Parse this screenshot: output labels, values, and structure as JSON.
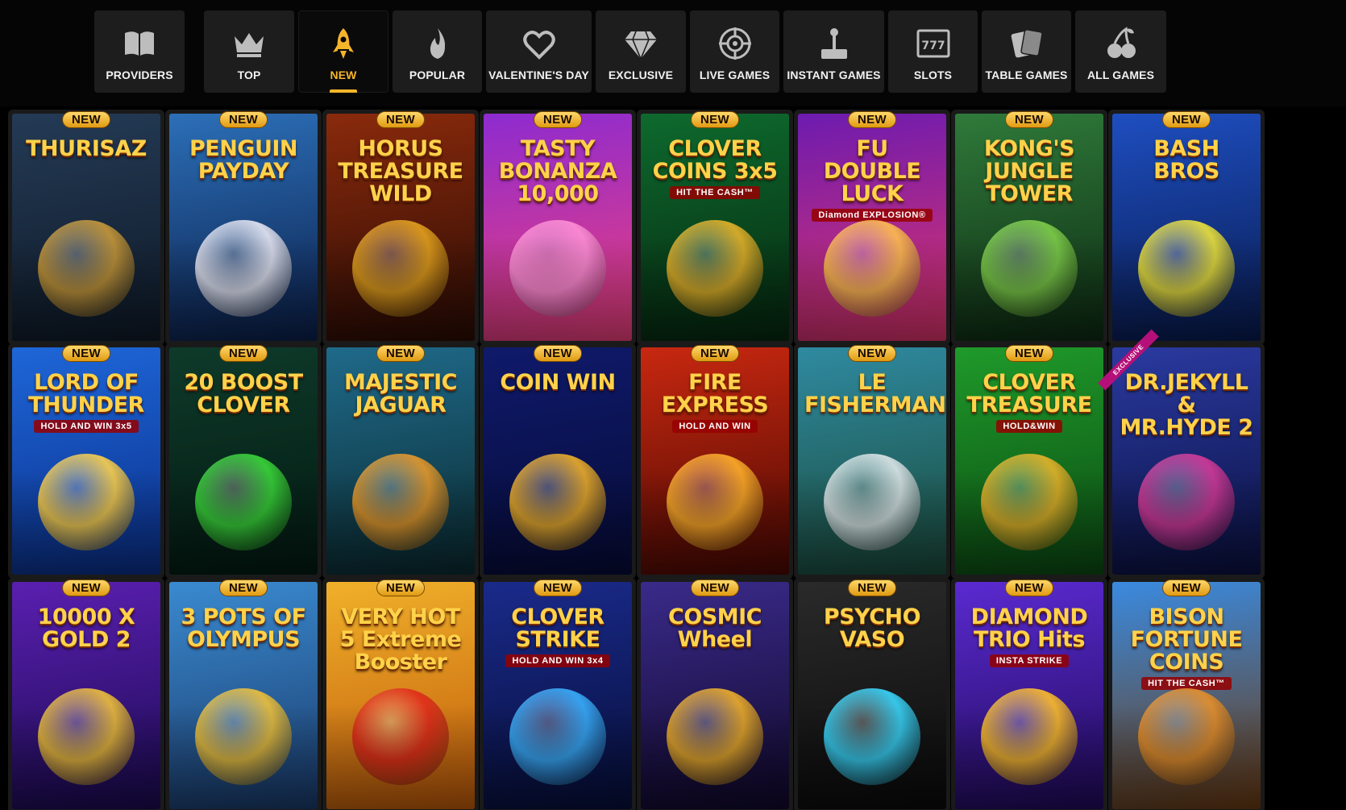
{
  "nav": {
    "categories": [
      {
        "label": "PROVIDERS",
        "icon": "book-icon",
        "active": false
      },
      {
        "label": "TOP",
        "icon": "crown-icon",
        "active": false
      },
      {
        "label": "NEW",
        "icon": "rocket-icon",
        "active": true
      },
      {
        "label": "POPULAR",
        "icon": "flame-icon",
        "active": false
      },
      {
        "label": "VALENTINE'S DAY",
        "icon": "heart-icon",
        "active": false
      },
      {
        "label": "EXCLUSIVE",
        "icon": "diamond-icon",
        "active": false
      },
      {
        "label": "LIVE GAMES",
        "icon": "roulette-icon",
        "active": false
      },
      {
        "label": "INSTANT GAMES",
        "icon": "joystick-icon",
        "active": false
      },
      {
        "label": "SLOTS",
        "icon": "slot-machine-icon",
        "active": false
      },
      {
        "label": "TABLE GAMES",
        "icon": "cards-icon",
        "active": false
      },
      {
        "label": "ALL GAMES",
        "icon": "cherries-icon",
        "active": false
      }
    ],
    "accent_color": "#f5b52a"
  },
  "games": [
    {
      "title": "THURISAZ",
      "subtitle": "",
      "badge": "NEW",
      "bg": [
        "#243a55",
        "#0e1a28"
      ],
      "accent": "#c99a3a"
    },
    {
      "title": "PENGUIN PAYDAY",
      "subtitle": "",
      "badge": "NEW",
      "bg": [
        "#2c6fb8",
        "#0b1f4a"
      ],
      "accent": "#e9e9f5"
    },
    {
      "title": "HORUS TREASURE WILD",
      "subtitle": "",
      "badge": "NEW",
      "bg": [
        "#8a2a0c",
        "#2a0b04"
      ],
      "accent": "#e4a21e"
    },
    {
      "title": "TASTY BONANZA 10,000",
      "subtitle": "",
      "badge": "NEW",
      "bg": [
        "#8d2bd0",
        "#f0407a"
      ],
      "accent": "#ff8fd6"
    },
    {
      "title": "CLOVER COINS 3x5",
      "subtitle": "HIT THE CASH™",
      "badge": "NEW",
      "bg": [
        "#0e6a2e",
        "#05270f"
      ],
      "accent": "#e8b42a"
    },
    {
      "title": "FU DOUBLE LUCK",
      "subtitle": "Diamond EXPLOSION®",
      "badge": "NEW",
      "bg": [
        "#6d1bb0",
        "#e0346a"
      ],
      "accent": "#ffc04d"
    },
    {
      "title": "KONG'S JUNGLE TOWER",
      "subtitle": "",
      "badge": "NEW",
      "bg": [
        "#2f7a3a",
        "#0d2a12"
      ],
      "accent": "#7fcf4a"
    },
    {
      "title": "BASH BROS",
      "subtitle": "",
      "badge": "NEW",
      "bg": [
        "#1e4ec0",
        "#081a4e"
      ],
      "accent": "#f0e63a"
    },
    {
      "title": "LORD OF THUNDER",
      "subtitle": "HOLD AND WIN 3x5",
      "badge": "NEW",
      "bg": [
        "#1e66d8",
        "#0a2f8a"
      ],
      "accent": "#ffd24a"
    },
    {
      "title": "20 BOOST CLOVER",
      "subtitle": "",
      "badge": "NEW",
      "bg": [
        "#0e3a2a",
        "#031a12"
      ],
      "accent": "#3ad93a"
    },
    {
      "title": "MAJESTIC JAGUAR",
      "subtitle": "",
      "badge": "NEW",
      "bg": [
        "#1f6a8a",
        "#0a2a30"
      ],
      "accent": "#e89a2a"
    },
    {
      "title": "COIN WIN",
      "subtitle": "",
      "badge": "NEW",
      "bg": [
        "#0f1a6a",
        "#060b38"
      ],
      "accent": "#f0b02a"
    },
    {
      "title": "FIRE EXPRESS",
      "subtitle": "HOLD AND WIN",
      "badge": "NEW",
      "bg": [
        "#c82810",
        "#4a0802"
      ],
      "accent": "#ffb02a"
    },
    {
      "title": "LE FISHERMAN",
      "subtitle": "",
      "badge": "NEW",
      "bg": [
        "#2f8aa0",
        "#1a4a3a"
      ],
      "accent": "#dfe8ea"
    },
    {
      "title": "CLOVER TREASURE",
      "subtitle": "HOLD&WIN",
      "badge": "NEW",
      "bg": [
        "#1f9a2a",
        "#0b4a12"
      ],
      "accent": "#e8b42a"
    },
    {
      "title": "DR.JEKYLL & MR.HYDE 2",
      "subtitle": "",
      "badge": "",
      "ribbon": "EXCLUSIVE",
      "bg": [
        "#2a3aa0",
        "#0a1040"
      ],
      "accent": "#d63a9a"
    },
    {
      "title": "10000 X GOLD 2",
      "subtitle": "",
      "badge": "NEW",
      "bg": [
        "#5a1fb0",
        "#1a0a50"
      ],
      "accent": "#f0c23a"
    },
    {
      "title": "3 POTS OF OLYMPUS",
      "subtitle": "",
      "badge": "NEW",
      "bg": [
        "#3a8ad0",
        "#1a3a6a"
      ],
      "accent": "#f0c23a"
    },
    {
      "title": "VERY HOT 5 Extreme Booster",
      "subtitle": "",
      "badge": "NEW",
      "bg": [
        "#f0b02a",
        "#c05a0a"
      ],
      "accent": "#e02a1a"
    },
    {
      "title": "CLOVER STRIKE",
      "subtitle": "HOLD AND WIN 3x4",
      "badge": "NEW",
      "bg": [
        "#1a2a8a",
        "#060e3a"
      ],
      "accent": "#3ab0ff"
    },
    {
      "title": "COSMIC Wheel",
      "subtitle": "",
      "badge": "NEW",
      "bg": [
        "#3a2a8a",
        "#10082a"
      ],
      "accent": "#f0b02a"
    },
    {
      "title": "PSYCHO VASO",
      "subtitle": "",
      "badge": "NEW",
      "bg": [
        "#2a2a2a",
        "#0a0a0a"
      ],
      "accent": "#3ad9ff"
    },
    {
      "title": "DIAMOND TRIO Hits",
      "subtitle": "INSTA STRIKE",
      "badge": "NEW",
      "bg": [
        "#5a2ad0",
        "#200a5a"
      ],
      "accent": "#ffc02a"
    },
    {
      "title": "BISON FORTUNE COINS",
      "subtitle": "HIT THE CASH™",
      "badge": "NEW",
      "bg": [
        "#3a8ae0",
        "#6a3a10"
      ],
      "accent": "#e8902a"
    }
  ]
}
